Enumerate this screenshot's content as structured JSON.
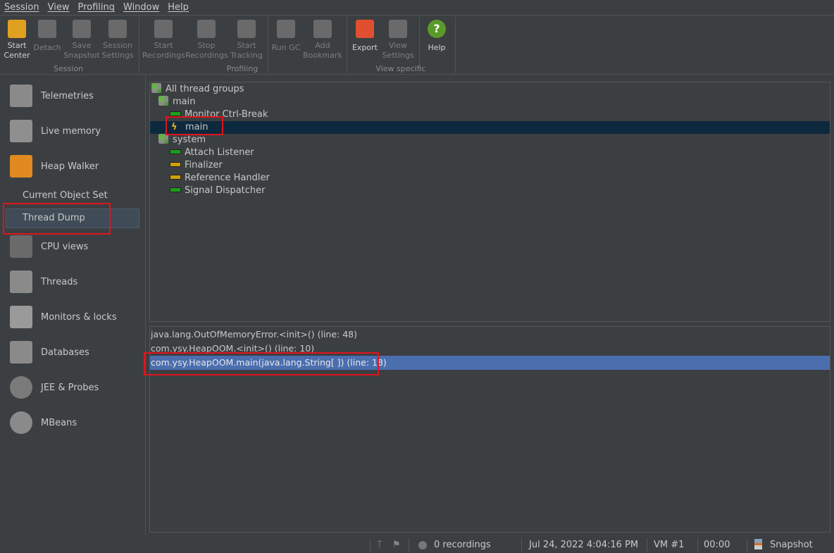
{
  "menu": [
    "Session",
    "View",
    "Profiling",
    "Window",
    "Help"
  ],
  "toolbar": {
    "buttons": [
      {
        "l1": "Start",
        "l2": "Center",
        "enabled": true,
        "icon": "start-center-icon",
        "color": "#e0a020"
      },
      {
        "l1": "Detach",
        "l2": "",
        "enabled": false,
        "icon": "detach-icon",
        "color": "#6a6a6a"
      },
      {
        "l1": "Save",
        "l2": "Snapshot",
        "enabled": false,
        "icon": "save-icon",
        "color": "#6a6a6a"
      },
      {
        "l1": "Session",
        "l2": "Settings",
        "enabled": false,
        "icon": "session-settings-icon",
        "color": "#6a6a6a"
      },
      {
        "l1": "Start",
        "l2": "Recordings",
        "enabled": false,
        "icon": "start-recordings-icon",
        "color": "#6a6a6a"
      },
      {
        "l1": "Stop",
        "l2": "Recordings",
        "enabled": false,
        "icon": "stop-recordings-icon",
        "color": "#6a6a6a"
      },
      {
        "l1": "Start",
        "l2": "Tracking",
        "enabled": false,
        "icon": "start-tracking-icon",
        "color": "#6a6a6a"
      },
      {
        "l1": "Run GC",
        "l2": "",
        "enabled": false,
        "icon": "run-gc-icon",
        "color": "#6a6a6a"
      },
      {
        "l1": "Add",
        "l2": "Bookmark",
        "enabled": false,
        "icon": "bookmark-icon",
        "color": "#6a6a6a"
      },
      {
        "l1": "Export",
        "l2": "",
        "enabled": true,
        "icon": "export-icon",
        "color": "#e05030"
      },
      {
        "l1": "View",
        "l2": "Settings",
        "enabled": false,
        "icon": "view-settings-icon",
        "color": "#6a6a6a"
      },
      {
        "l1": "Help",
        "l2": "",
        "enabled": true,
        "icon": "help-icon",
        "color": "#5a9a2a"
      }
    ],
    "groups": [
      "Session",
      "Profiling",
      "View specific"
    ]
  },
  "sidebar": {
    "items": [
      "Telemetries",
      "Live memory",
      "Heap Walker",
      "CPU views",
      "Threads",
      "Monitors & locks",
      "Databases",
      "JEE & Probes",
      "MBeans"
    ],
    "subitems": [
      "Current Object Set",
      "Thread Dump"
    ],
    "selected": "Thread Dump"
  },
  "threads": {
    "root": "All thread groups",
    "groups": [
      {
        "name": "main",
        "threads": [
          {
            "name": "Monitor Ctrl-Break",
            "state": "#1aa01a"
          },
          {
            "name": "main",
            "state": "current"
          }
        ]
      },
      {
        "name": "system",
        "threads": [
          {
            "name": "Attach Listener",
            "state": "#1aa01a"
          },
          {
            "name": "Finalizer",
            "state": "#d0a000"
          },
          {
            "name": "Reference Handler",
            "state": "#d0a000"
          },
          {
            "name": "Signal Dispatcher",
            "state": "#1aa01a"
          }
        ]
      }
    ]
  },
  "stack": [
    "java.lang.OutOfMemoryError.<init>() (line: 48)",
    "com.ysy.HeapOOM.<init>() (line: 10)",
    "com.ysy.HeapOOM.main(java.lang.String[ ]) (line: 18)"
  ],
  "status": {
    "recordings": "0 recordings",
    "datetime": "Jul 24, 2022 4:04:16 PM",
    "vm": "VM #1",
    "time": "00:00",
    "mode": "Snapshot"
  }
}
